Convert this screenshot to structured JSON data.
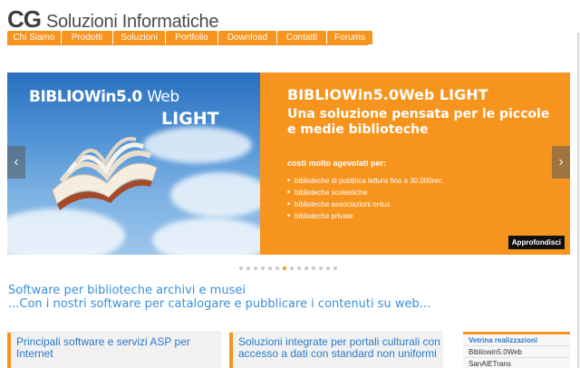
{
  "header": {
    "logo_cg": "CG",
    "logo_text": "Soluzioni Informatiche"
  },
  "nav": {
    "items": [
      {
        "label": "Chi Siamo"
      },
      {
        "label": "Prodotti"
      },
      {
        "label": "Soluzioni"
      },
      {
        "label": "Portfolio"
      },
      {
        "label": "Download"
      },
      {
        "label": "Contatti"
      },
      {
        "label": "Forums"
      }
    ]
  },
  "slider": {
    "left_title_bold": "BIBLIOWin5.0",
    "left_title_thin": "Web",
    "left_title_2": "LIGHT",
    "title": "BIBLIOWin5.0Web LIGHT",
    "subtitle": "Una soluzione pensata per le piccole e medie biblioteche",
    "costi": "costi molto agevolati per:",
    "bullets": [
      "biblioteche di pubblica lettura fino a 30.000rec.",
      "biblioteche scolastiche",
      "biblioteche associazioni onlus",
      "biblioteche private"
    ],
    "button_label": "Approfondisci",
    "prev_icon": "‹",
    "next_icon": "›",
    "slide_count": 14,
    "active_slide": 6
  },
  "headline": {
    "line1": "Software per biblioteche archivi e musei",
    "line2": "...Con i nostri software per catalogare e pubblicare i contenuti su web..."
  },
  "boxes": {
    "box1": "Principali software e servizi ASP per Internet",
    "box2": "Soluzioni integrate per portali culturali con accesso a dati con standard non uniformi"
  },
  "vetrina": {
    "title": "Vetrina realizzazioni",
    "items": [
      "Bibliowin5.0Web",
      "SanAlETrans"
    ]
  },
  "colors": {
    "accent": "#f7941d",
    "link_blue": "#3a8fd9"
  }
}
